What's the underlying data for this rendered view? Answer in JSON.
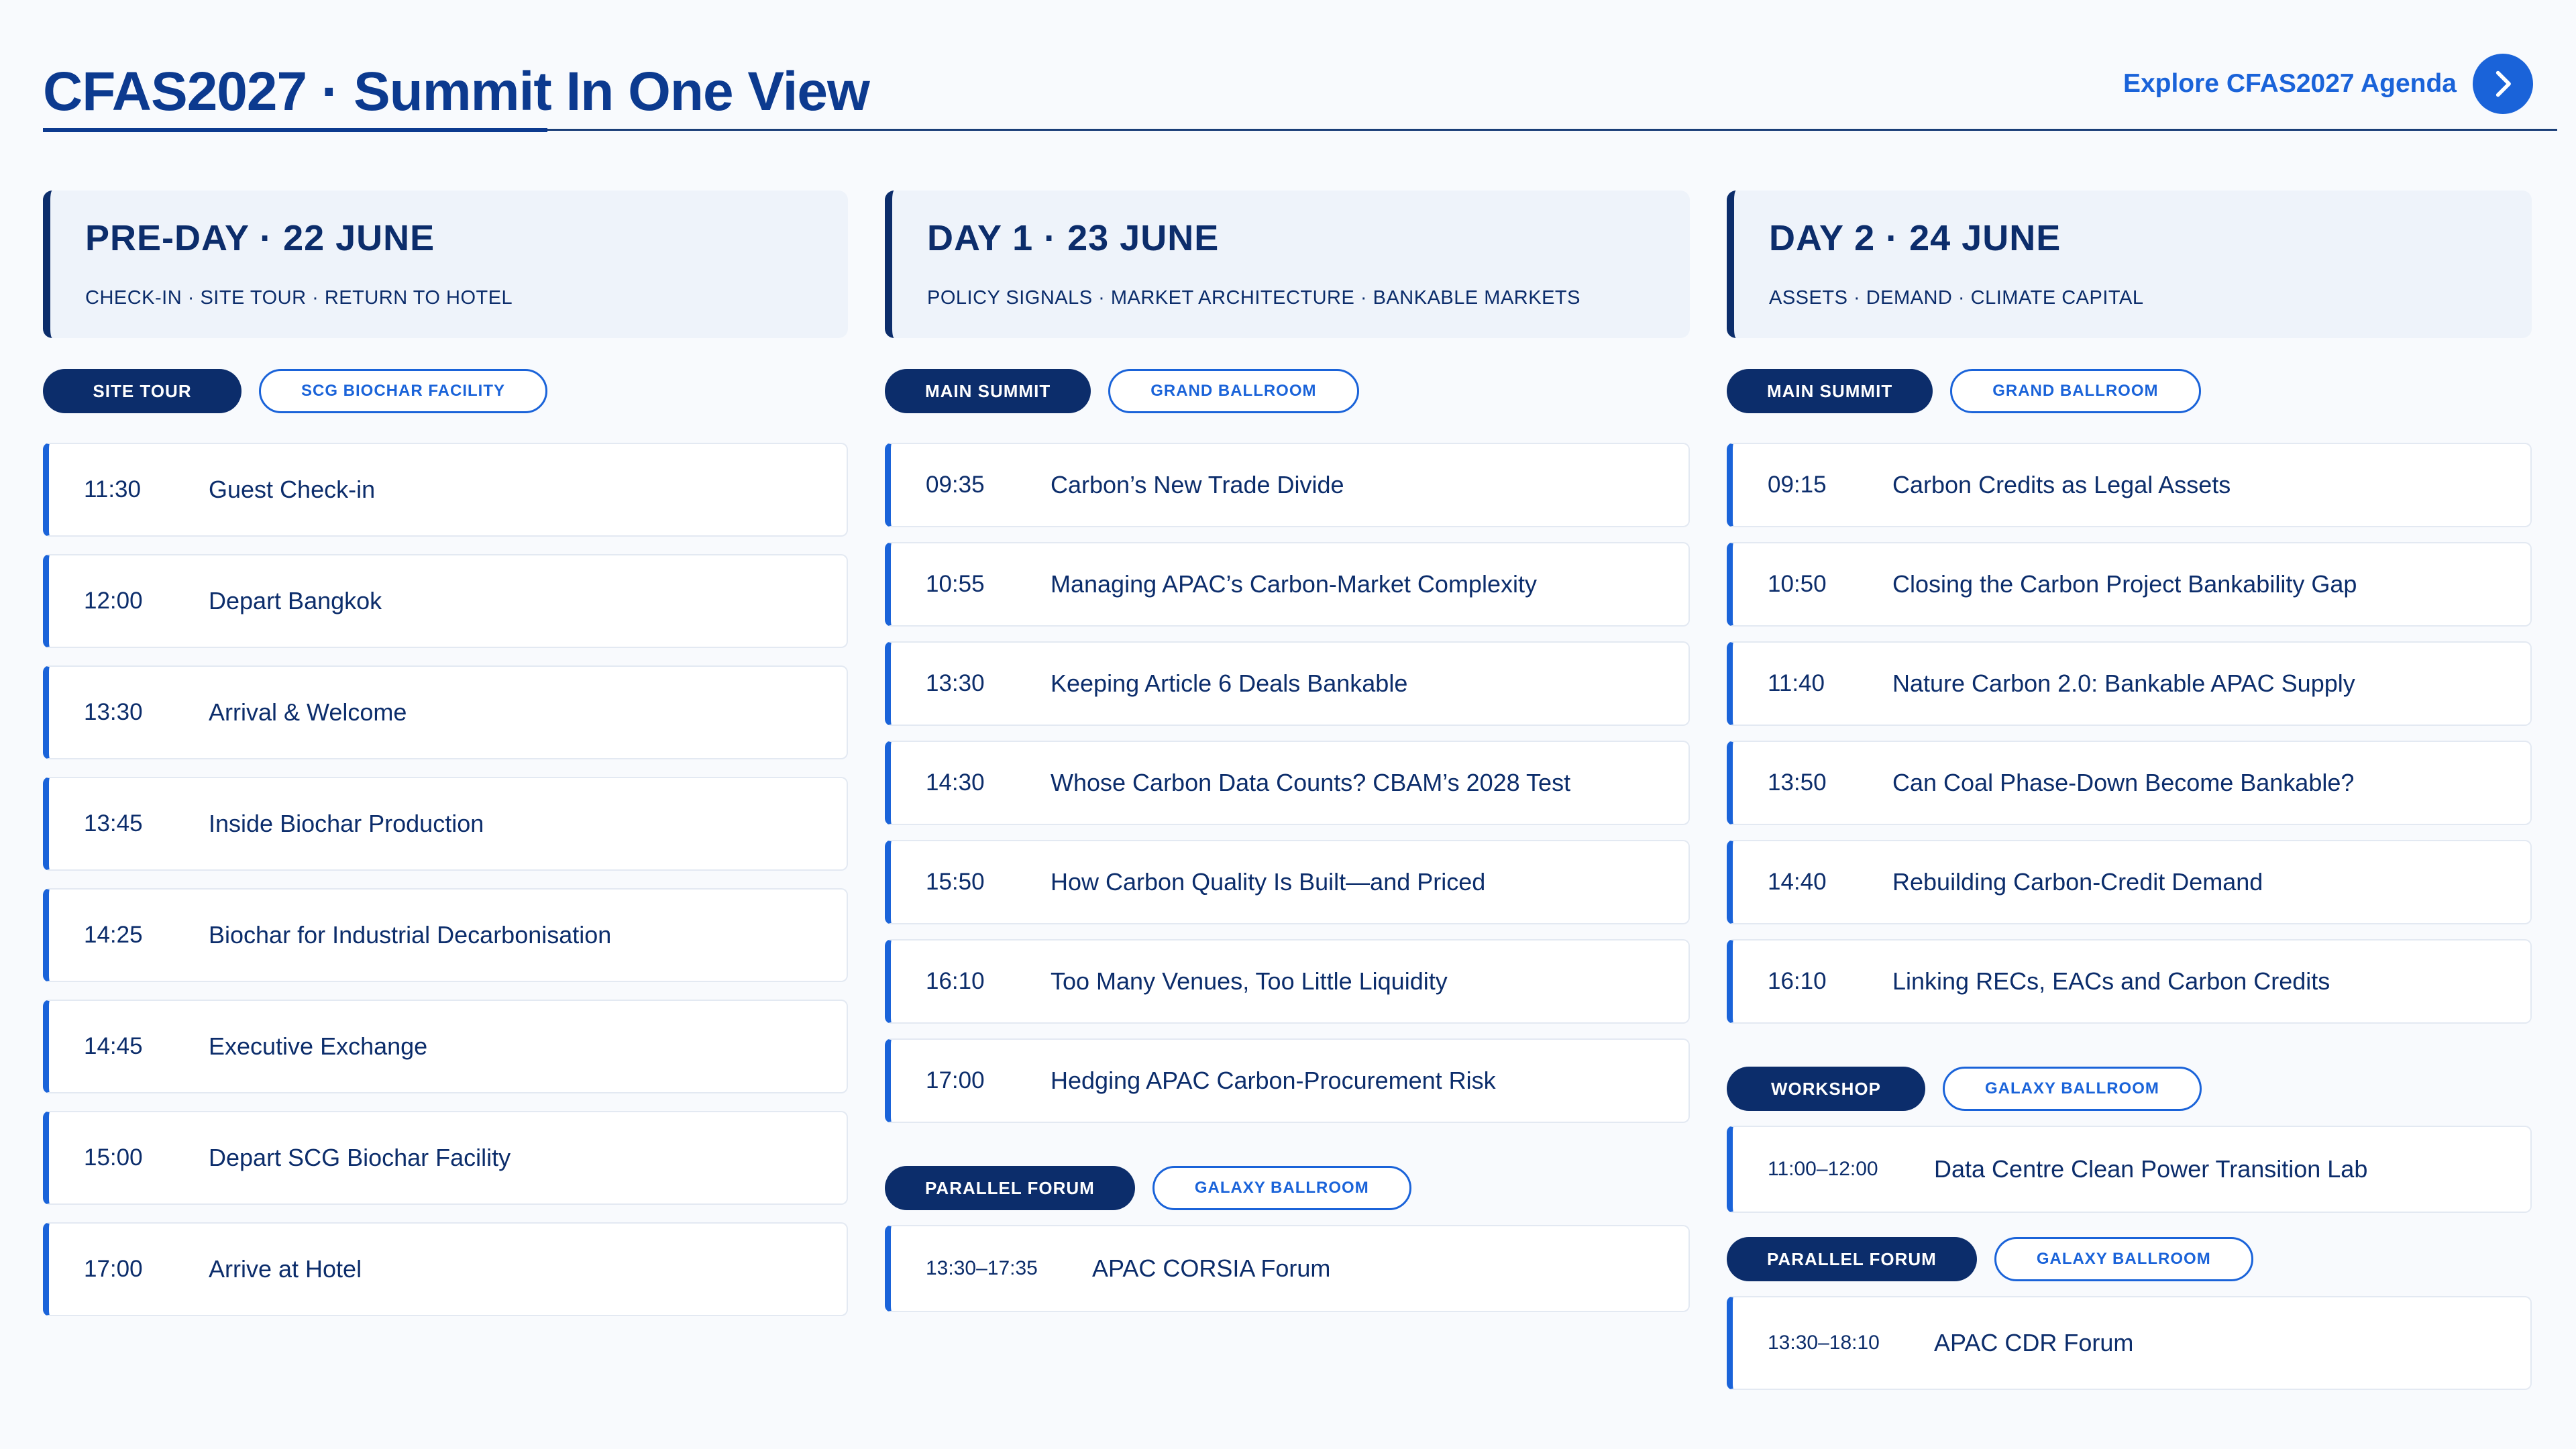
{
  "header": {
    "title": "CFAS2027 · Summit In One View",
    "explore_label": "Explore CFAS2027 Agenda"
  },
  "colors": {
    "navy": "#0c2d6b",
    "accent_blue": "#1a63d9",
    "panel_bg": "#eef3fa",
    "page_bg": "#f8fafd"
  },
  "days": [
    {
      "title": "PRE-DAY · 22 JUNE",
      "subtitle": "CHECK-IN · SITE TOUR · RETURN TO HOTEL",
      "type_label": "SITE TOUR",
      "venue_label": "SCG BIOCHAR FACILITY",
      "sessions": [
        {
          "time": "11:30",
          "title": "Guest Check-in"
        },
        {
          "time": "12:00",
          "title": "Depart Bangkok"
        },
        {
          "time": "13:30",
          "title": "Arrival & Welcome"
        },
        {
          "time": "13:45",
          "title": "Inside Biochar Production"
        },
        {
          "time": "14:25",
          "title": "Biochar for Industrial Decarbonisation"
        },
        {
          "time": "14:45",
          "title": "Executive Exchange"
        },
        {
          "time": "15:00",
          "title": "Depart SCG Biochar Facility"
        },
        {
          "time": "17:00",
          "title": "Arrive at Hotel"
        }
      ]
    },
    {
      "title": "DAY 1 · 23 JUNE",
      "subtitle": "POLICY SIGNALS · MARKET ARCHITECTURE · BANKABLE MARKETS",
      "type_label": "MAIN SUMMIT",
      "venue_label": "GRAND BALLROOM",
      "sessions": [
        {
          "time": "09:35",
          "title": "Carbon’s New Trade Divide"
        },
        {
          "time": "10:55",
          "title": "Managing APAC’s Carbon-Market Complexity"
        },
        {
          "time": "13:30",
          "title": "Keeping Article 6 Deals Bankable"
        },
        {
          "time": "14:30",
          "title": "Whose Carbon Data Counts? CBAM’s 2028 Test"
        },
        {
          "time": "15:50",
          "title": "How Carbon Quality Is Built—and Priced"
        },
        {
          "time": "16:10",
          "title": "Too Many Venues, Too Little Liquidity"
        },
        {
          "time": "17:00",
          "title": "Hedging APAC Carbon-Procurement Risk"
        }
      ],
      "extra": [
        {
          "type_label": "PARALLEL FORUM",
          "venue_label": "GALAXY BALLROOM",
          "sessions": [
            {
              "time": "13:30–17:35",
              "title": "APAC CORSIA Forum"
            }
          ]
        }
      ]
    },
    {
      "title": "DAY 2 · 24 JUNE",
      "subtitle": "ASSETS · DEMAND · CLIMATE CAPITAL",
      "type_label": "MAIN SUMMIT",
      "venue_label": "GRAND BALLROOM",
      "sessions": [
        {
          "time": "09:15",
          "title": "Carbon Credits as Legal Assets"
        },
        {
          "time": "10:50",
          "title": "Closing the Carbon Project Bankability Gap"
        },
        {
          "time": "11:40",
          "title": "Nature Carbon 2.0: Bankable APAC Supply"
        },
        {
          "time": "13:50",
          "title": "Can Coal Phase-Down Become Bankable?"
        },
        {
          "time": "14:40",
          "title": "Rebuilding Carbon-Credit Demand"
        },
        {
          "time": "16:10",
          "title": "Linking RECs, EACs and Carbon Credits"
        }
      ],
      "extra": [
        {
          "type_label": "WORKSHOP",
          "venue_label": "GALAXY BALLROOM",
          "sessions": [
            {
              "time": "11:00–12:00",
              "title": "Data Centre Clean Power Transition Lab"
            }
          ]
        },
        {
          "type_label": "PARALLEL FORUM",
          "venue_label": "GALAXY BALLROOM",
          "sessions": [
            {
              "time": "13:30–18:10",
              "title": "APAC CDR Forum"
            }
          ]
        }
      ]
    }
  ]
}
